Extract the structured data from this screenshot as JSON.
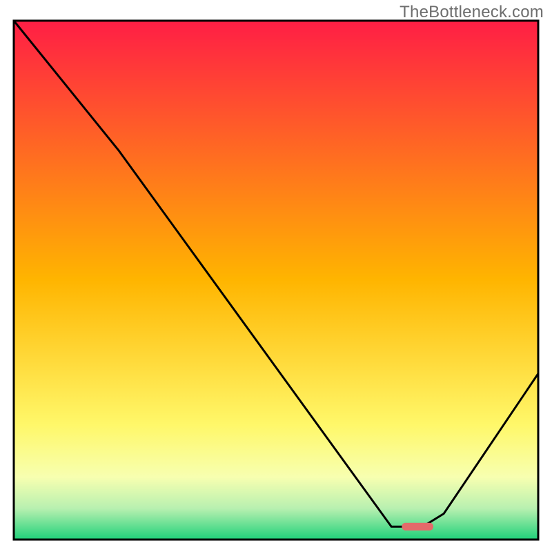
{
  "watermark": {
    "text": "TheBottleneck.com"
  },
  "chart_data": {
    "type": "line",
    "title": "",
    "xlabel": "",
    "ylabel": "",
    "xlim": [
      0,
      100
    ],
    "ylim": [
      0,
      100
    ],
    "grid": false,
    "legend": null,
    "background_gradient": {
      "stops": [
        {
          "offset": 0.0,
          "color": "#ff1e45"
        },
        {
          "offset": 0.5,
          "color": "#ffb500"
        },
        {
          "offset": 0.78,
          "color": "#fff86a"
        },
        {
          "offset": 0.88,
          "color": "#f7ffb0"
        },
        {
          "offset": 0.94,
          "color": "#b8f0b0"
        },
        {
          "offset": 1.0,
          "color": "#1fd17a"
        }
      ]
    },
    "series": [
      {
        "name": "bottleneck-curve",
        "type": "line",
        "color": "#000000",
        "x": [
          0,
          12,
          20,
          72,
          78,
          82,
          100
        ],
        "values": [
          100,
          85,
          75,
          2.5,
          2.5,
          5,
          32
        ]
      }
    ],
    "marker": {
      "name": "optimal-range",
      "color": "#e46a6a",
      "x_start": 74,
      "x_end": 80,
      "y": 2.5
    },
    "axes": {
      "frame_color": "#000000",
      "frame_width": 3
    }
  }
}
